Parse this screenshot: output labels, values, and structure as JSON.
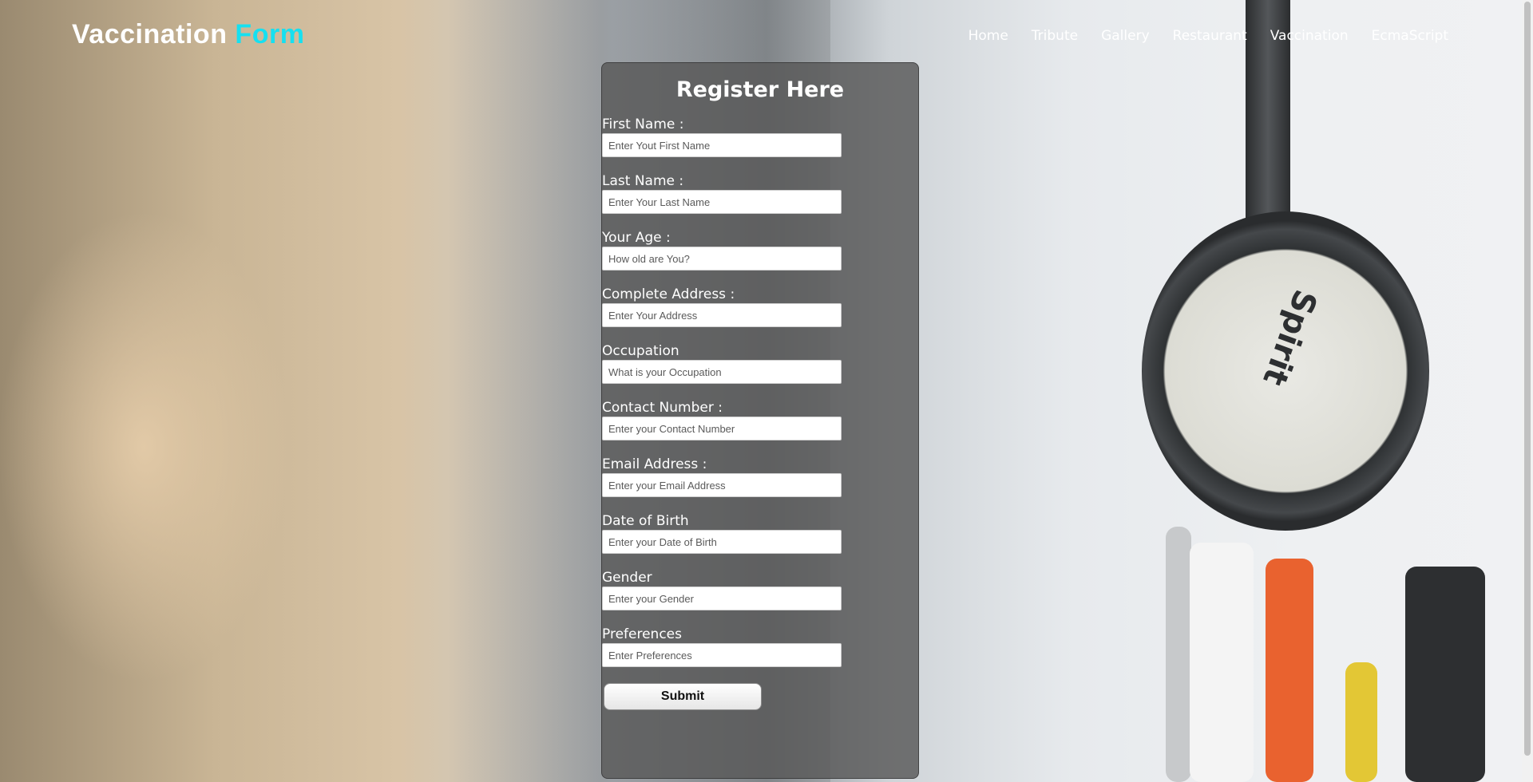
{
  "header": {
    "logo_main": "Vaccination",
    "logo_accent": "Form",
    "nav": [
      "Home",
      "Tribute",
      "Gallery",
      "Restaurant",
      "Vaccination",
      "EcmaScript"
    ]
  },
  "form": {
    "title": "Register Here",
    "fields": [
      {
        "label": "First Name :",
        "placeholder": "Enter Yout First Name"
      },
      {
        "label": "Last Name :",
        "placeholder": "Enter Your Last Name"
      },
      {
        "label": "Your Age :",
        "placeholder": "How old are You?"
      },
      {
        "label": "Complete Address :",
        "placeholder": "Enter Your Address"
      },
      {
        "label": "Occupation",
        "placeholder": "What is your Occupation"
      },
      {
        "label": "Contact Number :",
        "placeholder": "Enter your Contact Number"
      },
      {
        "label": "Email Address :",
        "placeholder": "Enter your Email Address"
      },
      {
        "label": "Date of Birth",
        "placeholder": "Enter your Date of Birth"
      },
      {
        "label": "Gender",
        "placeholder": "Enter your Gender"
      },
      {
        "label": "Preferences",
        "placeholder": "Enter Preferences"
      }
    ],
    "submit_label": "Submit"
  },
  "background": {
    "stethoscope_label": "Spirit"
  },
  "colors": {
    "accent": "#16e0f0",
    "panel": "#585858",
    "text": "#ffffff"
  }
}
